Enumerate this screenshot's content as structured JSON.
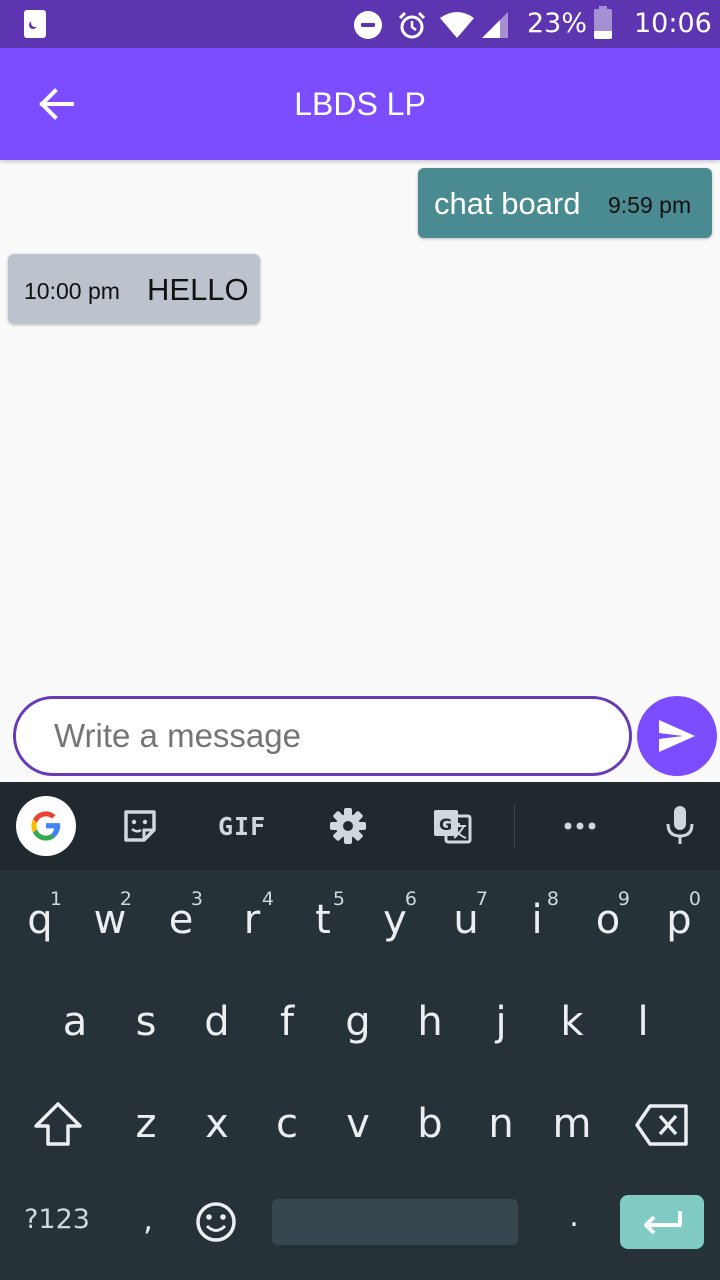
{
  "status_bar": {
    "battery_percent": "23%",
    "time": "10:06",
    "icons": [
      "app-notification-icon",
      "do-not-disturb-icon",
      "alarm-icon",
      "wifi-icon",
      "cell-signal-icon",
      "battery-icon"
    ]
  },
  "app_bar": {
    "title": "LBDS LP",
    "back_icon": "arrow-back-icon"
  },
  "messages": [
    {
      "direction": "outgoing",
      "text": "chat board",
      "time": "9:59 pm"
    },
    {
      "direction": "incoming",
      "text": "HELLO",
      "time": "10:00 pm"
    }
  ],
  "composer": {
    "placeholder": "Write a message",
    "value": "",
    "send_icon": "send-icon"
  },
  "keyboard": {
    "toolbar": [
      "google-icon",
      "sticker-icon",
      "GIF",
      "gear-icon",
      "translate-icon",
      "more-icon",
      "mic-icon"
    ],
    "gif_label": "GIF",
    "row1": [
      {
        "k": "q",
        "n": "1"
      },
      {
        "k": "w",
        "n": "2"
      },
      {
        "k": "e",
        "n": "3"
      },
      {
        "k": "r",
        "n": "4"
      },
      {
        "k": "t",
        "n": "5"
      },
      {
        "k": "y",
        "n": "6"
      },
      {
        "k": "u",
        "n": "7"
      },
      {
        "k": "i",
        "n": "8"
      },
      {
        "k": "o",
        "n": "9"
      },
      {
        "k": "p",
        "n": "0"
      }
    ],
    "row2": [
      "a",
      "s",
      "d",
      "f",
      "g",
      "h",
      "j",
      "k",
      "l"
    ],
    "row3": [
      "z",
      "x",
      "c",
      "v",
      "b",
      "n",
      "m"
    ],
    "symbols_label": "?123",
    "comma_label": ",",
    "period_label": ".",
    "colors": {
      "background": "#263238",
      "enter": "#80cbc4"
    }
  },
  "colors": {
    "status_bar": "#5e35b1",
    "app_bar": "#7c4dff",
    "outgoing_bubble": "#4a8a91",
    "incoming_bubble": "#bdc3cd"
  }
}
